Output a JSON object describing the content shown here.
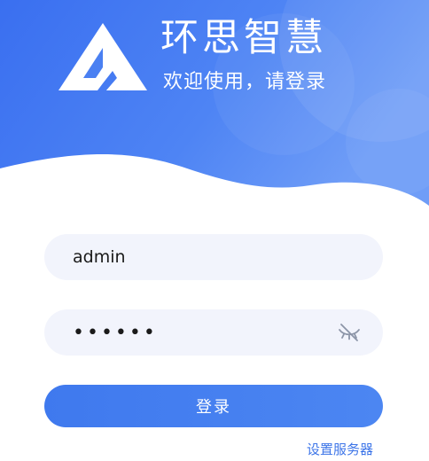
{
  "header": {
    "title": "环思智慧",
    "subtitle": "欢迎使用，请登录",
    "logo_icon": "triangle-logo-icon"
  },
  "form": {
    "username_value": "admin",
    "password_value": "••••••",
    "password_visibility_icon": "eye-off-icon",
    "login_label": "登录"
  },
  "footer": {
    "server_settings_label": "设置服务器"
  },
  "colors": {
    "primary": "#3f79ee",
    "header_gradient_start": "#3a6ff0",
    "header_gradient_end": "#6f9df7",
    "input_background": "#f2f4fc",
    "link": "#3d75e8"
  }
}
